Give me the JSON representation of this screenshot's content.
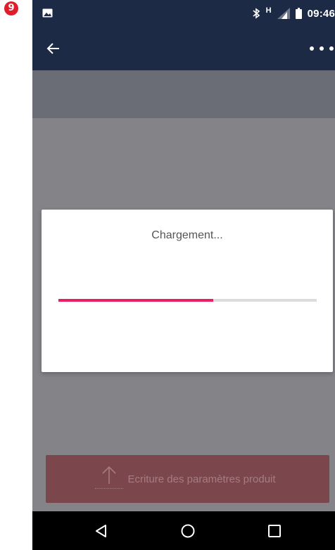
{
  "annotation": {
    "step_number": "9",
    "badge_color": "#e01e2b"
  },
  "status_bar": {
    "network_type": "H",
    "time": "09:46",
    "icons": [
      "gallery-icon",
      "bluetooth-icon",
      "signal-icon",
      "battery-icon"
    ],
    "background": "#1d2a46"
  },
  "app_bar": {
    "icons": [
      "back-arrow-icon",
      "more-options-icon"
    ],
    "background": "#1d2a46"
  },
  "dialog": {
    "title": "Chargement...",
    "progress_fraction": 0.6,
    "progress_color": "#e91e63",
    "track_color": "#dcdcdc"
  },
  "action_button": {
    "label": "Ecriture des paramètres produit",
    "icon": "upload-arrow-icon",
    "background": "#7b474d"
  },
  "nav_bar": {
    "icons": [
      "nav-back-icon",
      "nav-home-icon",
      "nav-recents-icon"
    ]
  }
}
